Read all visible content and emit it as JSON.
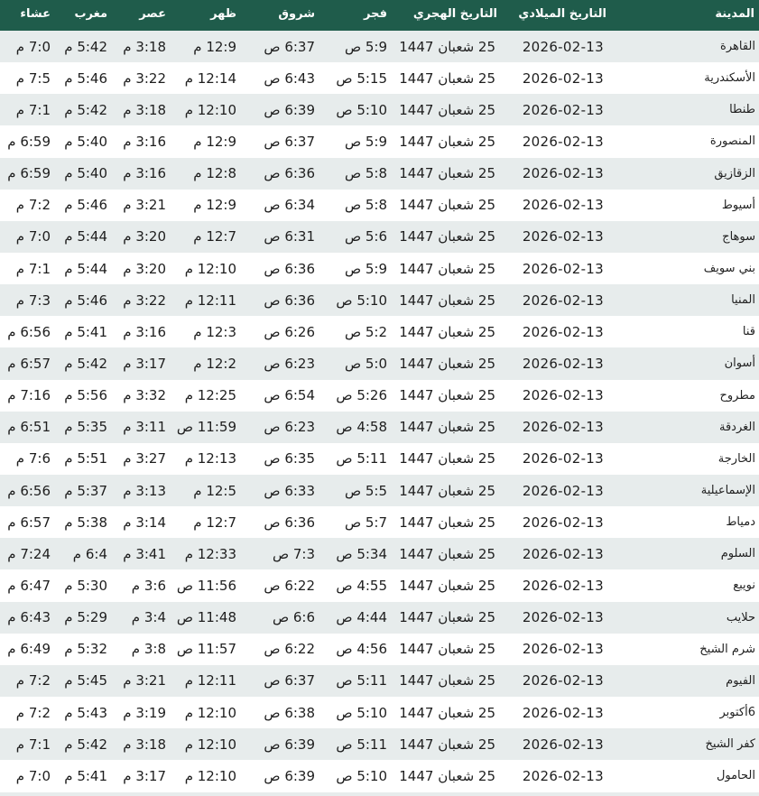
{
  "table": {
    "headers": {
      "city": "المدينة",
      "gregorian": "التاريخ الميلادي",
      "hijri": "التاريخ الهجري",
      "fajr": "فجر",
      "shuruq": "شروق",
      "dhuhr": "ظهر",
      "asr": "عصر",
      "maghrib": "مغرب",
      "isha": "عشاء"
    },
    "rows": [
      [
        "القاهرة",
        "2026-02-13",
        "25 شعبان 1447",
        "5:9 ص",
        "6:37 ص",
        "12:9 م",
        "3:18 م",
        "5:42 م",
        "7:0 م"
      ],
      [
        "الأسكندرية",
        "2026-02-13",
        "25 شعبان 1447",
        "5:15 ص",
        "6:43 ص",
        "12:14 م",
        "3:22 م",
        "5:46 م",
        "7:5 م"
      ],
      [
        "طنطا",
        "2026-02-13",
        "25 شعبان 1447",
        "5:10 ص",
        "6:39 ص",
        "12:10 م",
        "3:18 م",
        "5:42 م",
        "7:1 م"
      ],
      [
        "المنصورة",
        "2026-02-13",
        "25 شعبان 1447",
        "5:9 ص",
        "6:37 ص",
        "12:9 م",
        "3:16 م",
        "5:40 م",
        "6:59 م"
      ],
      [
        "الزقازيق",
        "2026-02-13",
        "25 شعبان 1447",
        "5:8 ص",
        "6:36 ص",
        "12:8 م",
        "3:16 م",
        "5:40 م",
        "6:59 م"
      ],
      [
        "أسيوط",
        "2026-02-13",
        "25 شعبان 1447",
        "5:8 ص",
        "6:34 ص",
        "12:9 م",
        "3:21 م",
        "5:46 م",
        "7:2 م"
      ],
      [
        "سوهاج",
        "2026-02-13",
        "25 شعبان 1447",
        "5:6 ص",
        "6:31 ص",
        "12:7 م",
        "3:20 م",
        "5:44 م",
        "7:0 م"
      ],
      [
        "بني سويف",
        "2026-02-13",
        "25 شعبان 1447",
        "5:9 ص",
        "6:36 ص",
        "12:10 م",
        "3:20 م",
        "5:44 م",
        "7:1 م"
      ],
      [
        "المنيا",
        "2026-02-13",
        "25 شعبان 1447",
        "5:10 ص",
        "6:36 ص",
        "12:11 م",
        "3:22 م",
        "5:46 م",
        "7:3 م"
      ],
      [
        "قنا",
        "2026-02-13",
        "25 شعبان 1447",
        "5:2 ص",
        "6:26 ص",
        "12:3 م",
        "3:16 م",
        "5:41 م",
        "6:56 م"
      ],
      [
        "أسوان",
        "2026-02-13",
        "25 شعبان 1447",
        "5:0 ص",
        "6:23 ص",
        "12:2 م",
        "3:17 م",
        "5:42 م",
        "6:57 م"
      ],
      [
        "مطروح",
        "2026-02-13",
        "25 شعبان 1447",
        "5:26 ص",
        "6:54 ص",
        "12:25 م",
        "3:32 م",
        "5:56 م",
        "7:16 م"
      ],
      [
        "الغردقة",
        "2026-02-13",
        "25 شعبان 1447",
        "4:58 ص",
        "6:23 ص",
        "11:59 ص",
        "3:11 م",
        "5:35 م",
        "6:51 م"
      ],
      [
        "الخارجة",
        "2026-02-13",
        "25 شعبان 1447",
        "5:11 ص",
        "6:35 ص",
        "12:13 م",
        "3:27 م",
        "5:51 م",
        "7:6 م"
      ],
      [
        "الإسماعيلية",
        "2026-02-13",
        "25 شعبان 1447",
        "5:5 ص",
        "6:33 ص",
        "12:5 م",
        "3:13 م",
        "5:37 م",
        "6:56 م"
      ],
      [
        "دمياط",
        "2026-02-13",
        "25 شعبان 1447",
        "5:7 ص",
        "6:36 ص",
        "12:7 م",
        "3:14 م",
        "5:38 م",
        "6:57 م"
      ],
      [
        "السلوم",
        "2026-02-13",
        "25 شعبان 1447",
        "5:34 ص",
        "7:3 ص",
        "12:33 م",
        "3:41 م",
        "6:4 م",
        "7:24 م"
      ],
      [
        "نويبع",
        "2026-02-13",
        "25 شعبان 1447",
        "4:55 ص",
        "6:22 ص",
        "11:56 ص",
        "3:6 م",
        "5:30 م",
        "6:47 م"
      ],
      [
        "حلايب",
        "2026-02-13",
        "25 شعبان 1447",
        "4:44 ص",
        "6:6 ص",
        "11:48 ص",
        "3:4 م",
        "5:29 م",
        "6:43 م"
      ],
      [
        "شرم الشيخ",
        "2026-02-13",
        "25 شعبان 1447",
        "4:56 ص",
        "6:22 ص",
        "11:57 ص",
        "3:8 م",
        "5:32 م",
        "6:49 م"
      ],
      [
        "الفيوم",
        "2026-02-13",
        "25 شعبان 1447",
        "5:11 ص",
        "6:37 ص",
        "12:11 م",
        "3:21 م",
        "5:45 م",
        "7:2 م"
      ],
      [
        "6أكتوبر",
        "2026-02-13",
        "25 شعبان 1447",
        "5:10 ص",
        "6:38 ص",
        "12:10 م",
        "3:19 م",
        "5:43 م",
        "7:2 م"
      ],
      [
        "كفر الشيخ",
        "2026-02-13",
        "25 شعبان 1447",
        "5:11 ص",
        "6:39 ص",
        "12:10 م",
        "3:18 م",
        "5:42 م",
        "7:1 م"
      ],
      [
        "الحامول",
        "2026-02-13",
        "25 شعبان 1447",
        "5:10 ص",
        "6:39 ص",
        "12:10 م",
        "3:17 م",
        "5:41 م",
        "7:0 م"
      ]
    ]
  },
  "colors": {
    "header_bg": "#1f5c4b",
    "row_alt_bg": "#e7ecec",
    "row_bg": "#ffffff"
  }
}
